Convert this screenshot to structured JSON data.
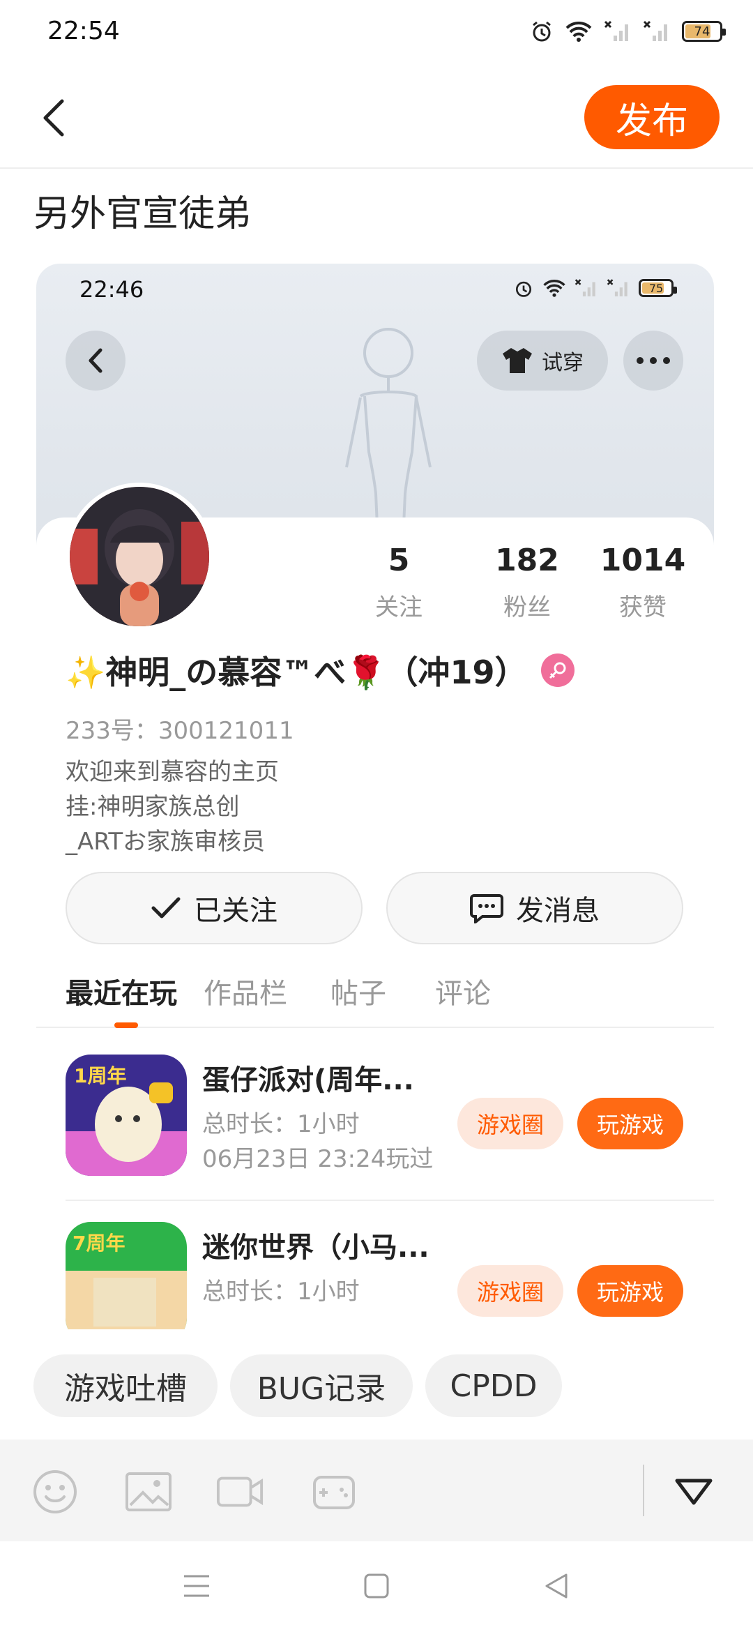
{
  "status_bar": {
    "time": "22:54",
    "battery": "74"
  },
  "header": {
    "publish_label": "发布"
  },
  "post": {
    "title": "另外官宣徒弟"
  },
  "screenshot": {
    "status_time": "22:46",
    "status_battery": "75",
    "try_on_label": "试穿",
    "stats": [
      {
        "value": "5",
        "label": "关注"
      },
      {
        "value": "182",
        "label": "粉丝"
      },
      {
        "value": "1014",
        "label": "获赞"
      }
    ],
    "name": "✨神明_の慕容™べ🌹（冲19）",
    "uid": "233号：300121011",
    "bio": [
      "欢迎来到慕容的主页",
      "挂:神明家族总创",
      "_ARTお家族审核员"
    ],
    "follow_label": "已关注",
    "message_label": "发消息",
    "tabs": [
      "最近在玩",
      "作品栏",
      "帖子",
      "评论"
    ],
    "games": [
      {
        "name": "蛋仔派对(周年...",
        "duration": "总时长：1小时",
        "last_played": "06月23日 23:24玩过",
        "circle_label": "游戏圈",
        "play_label": "玩游戏",
        "icon_badge": "1周年"
      },
      {
        "name": "迷你世界（小马...",
        "duration": "总时长：1小时",
        "last_played": "",
        "circle_label": "游戏圈",
        "play_label": "玩游戏",
        "icon_badge": "7周年"
      }
    ]
  },
  "topics": [
    "游戏吐槽",
    "BUG记录",
    "CPDD"
  ],
  "colors": {
    "accent": "#ff5a00",
    "accent_light": "#fde7dc"
  }
}
